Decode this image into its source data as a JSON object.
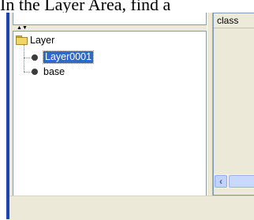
{
  "caption": {
    "text": "In the Layer Area, find a"
  },
  "tree": {
    "root": {
      "label": "Layer",
      "icon": "folder-icon"
    },
    "children": [
      {
        "label": "Layer0001",
        "selected": true,
        "icon": "bullet-icon"
      },
      {
        "label": "base",
        "selected": false,
        "icon": "bullet-icon"
      }
    ]
  },
  "list": {
    "column_header": "class"
  },
  "colors": {
    "selection": "#316ac5",
    "window_edge": "#1a44b0",
    "panel_bg": "#ece9d8"
  }
}
